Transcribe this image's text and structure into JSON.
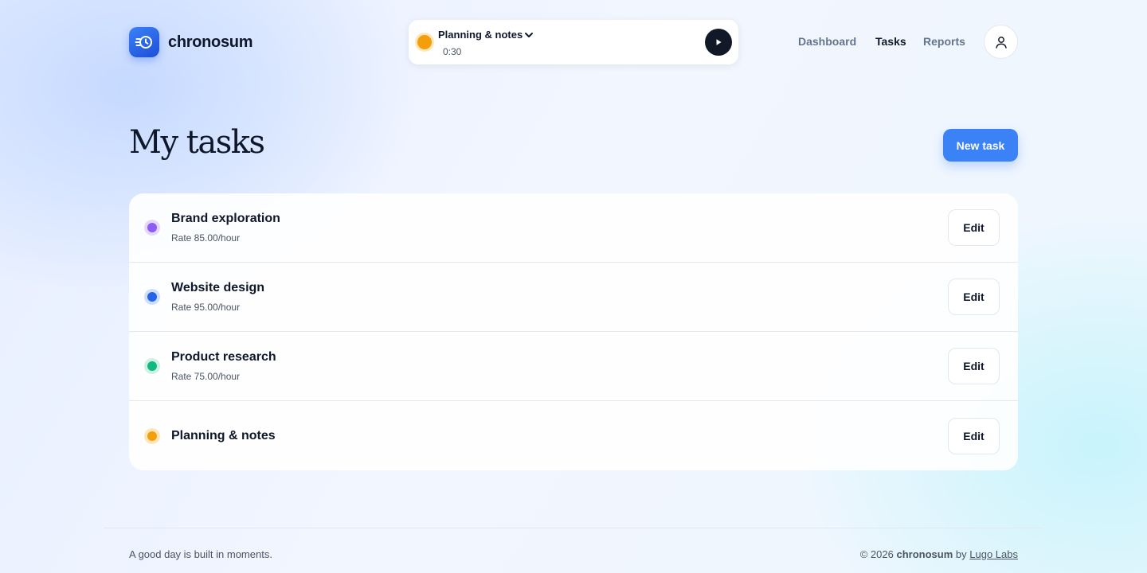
{
  "app": {
    "name": "chronosum",
    "logo_icon": "clock-history-icon",
    "brand_color": "#2563eb"
  },
  "timer": {
    "task": "Planning & notes",
    "elapsed": "0:30",
    "color": "#f59e0b",
    "dropdown_icon": "chevron-down-icon",
    "play_icon": "play-icon"
  },
  "nav": {
    "items": [
      {
        "label": "Dashboard",
        "active": false
      },
      {
        "label": "Tasks",
        "active": true
      },
      {
        "label": "Reports",
        "active": false
      }
    ],
    "user_icon": "user-icon"
  },
  "page": {
    "title": "My tasks",
    "new_task_label": "New task"
  },
  "tasks": [
    {
      "name": "Brand exploration",
      "rate": "Rate 85.00/hour",
      "color": "#8b5cf6",
      "edit_label": "Edit"
    },
    {
      "name": "Website design",
      "rate": "Rate 95.00/hour",
      "color": "#2563eb",
      "edit_label": "Edit"
    },
    {
      "name": "Product research",
      "rate": "Rate 75.00/hour",
      "color": "#10b981",
      "edit_label": "Edit"
    },
    {
      "name": "Planning & notes",
      "rate": "",
      "color": "#f59e0b",
      "edit_label": "Edit"
    }
  ],
  "footer": {
    "tagline": "A good day is built in moments.",
    "copyright_prefix": "© 2026",
    "copyright_brand": "chronosum",
    "copyright_by": "by",
    "copyright_company": "Lugo Labs"
  }
}
